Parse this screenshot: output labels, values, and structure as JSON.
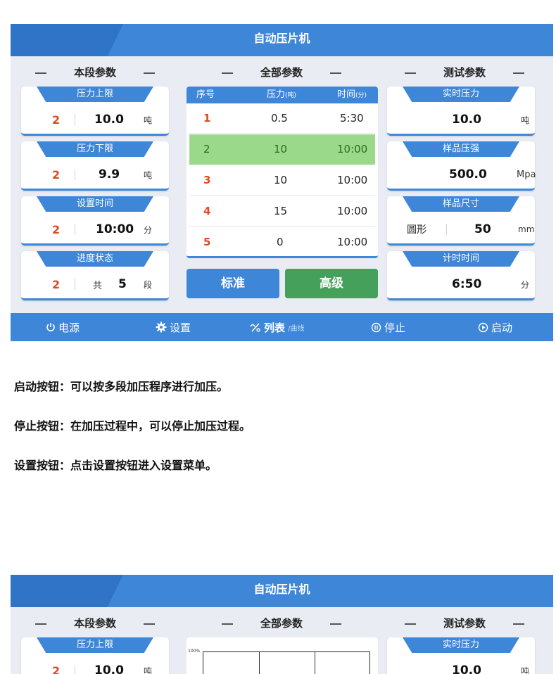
{
  "title": "自动压片机",
  "sections": {
    "current": "本段参数",
    "all": "全部参数",
    "test": "测试参数"
  },
  "left_cards": [
    {
      "label": "压力上限",
      "index": "2",
      "value": "10.0",
      "unit": "吨"
    },
    {
      "label": "压力下限",
      "index": "2",
      "value": "9.9",
      "unit": "吨"
    },
    {
      "label": "设置时间",
      "index": "2",
      "value": "10:00",
      "unit": "分"
    },
    {
      "label": "进度状态",
      "index": "2",
      "prefix": "共",
      "value": "5",
      "unit": "段"
    }
  ],
  "table": {
    "headers": {
      "seq": "序号",
      "pressure": "压力",
      "pressure_unit": "(吨)",
      "time": "时间",
      "time_unit": "(分)"
    },
    "rows": [
      {
        "seq": "1",
        "pressure": "0.5",
        "time": "5:30"
      },
      {
        "seq": "2",
        "pressure": "10",
        "time": "10:00",
        "active": true
      },
      {
        "seq": "3",
        "pressure": "10",
        "time": "10:00"
      },
      {
        "seq": "4",
        "pressure": "15",
        "time": "10:00"
      },
      {
        "seq": "5",
        "pressure": "0",
        "time": "10:00"
      }
    ]
  },
  "buttons": {
    "standard": "标准",
    "advanced": "高级"
  },
  "right_cards": [
    {
      "label": "实时压力",
      "value": "10.0",
      "unit": "吨"
    },
    {
      "label": "样品压强",
      "value": "500.0",
      "unit": "Mpa"
    },
    {
      "label": "样品尺寸",
      "shape": "圆形",
      "value": "50",
      "unit": "mm"
    },
    {
      "label": "计时时间",
      "value": "6:50",
      "unit": "分"
    }
  ],
  "nav": {
    "power": "电源",
    "settings": "设置",
    "list": "列表",
    "curve": "/曲线",
    "stop": "停止",
    "start": "启动"
  },
  "descriptions": [
    "启动按钮：可以按多段加压程序进行加压。",
    "停止按钮：在加压过程中，可以停止加压过程。",
    "设置按钮：点击设置按钮进入设置菜单。"
  ],
  "panel2": {
    "title": "自动压片机",
    "sections": {
      "current": "本段参数",
      "all": "全部参数",
      "test": "测试参数"
    },
    "left_card": {
      "label": "压力上限",
      "index": "2",
      "value": "10.0",
      "unit": "吨"
    },
    "right_card": {
      "label": "实时压力",
      "value": "10.0",
      "unit": "吨"
    },
    "chart_y_label": "100%"
  },
  "colors": {
    "primary": "#3e86d8",
    "dark": "#2f74c6",
    "green": "#45a05c",
    "highlight": "#9bd98a",
    "red": "#e04a1f"
  }
}
